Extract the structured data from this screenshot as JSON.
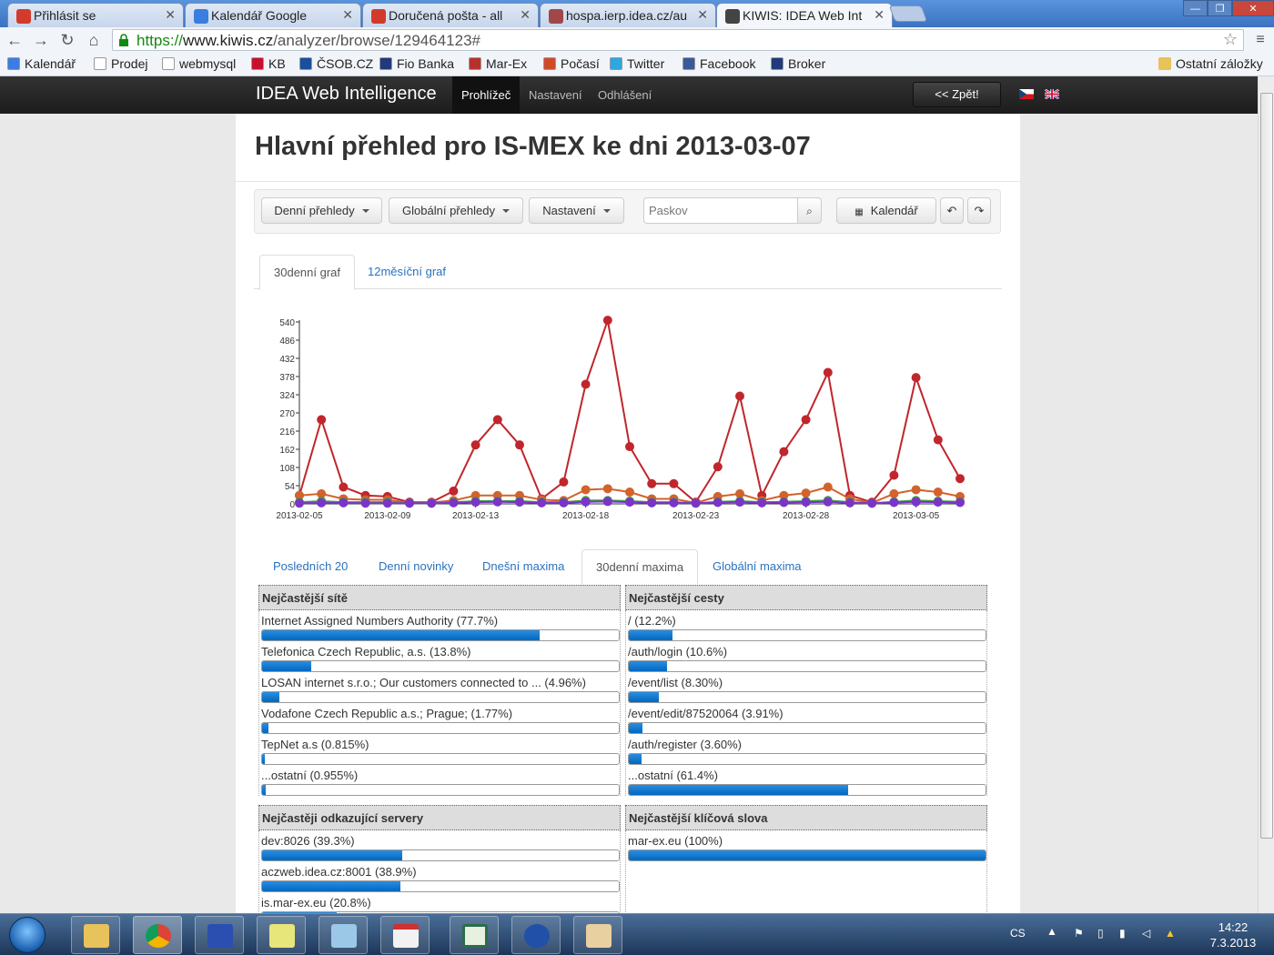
{
  "browser": {
    "tabs": [
      {
        "title": "Přihlásit se",
        "icon_color": "#d23b2c"
      },
      {
        "title": "Kalendář Google",
        "icon_color": "#3b7de0"
      },
      {
        "title": "Doručená pošta - all",
        "icon_color": "#d23b2c"
      },
      {
        "title": "hospa.ierp.idea.cz/au",
        "icon_color": "#a04848"
      },
      {
        "title": "KIWIS: IDEA Web Int",
        "icon_color": "#444444"
      }
    ],
    "url_scheme": "https://",
    "url_host": "www.kiwis.cz",
    "url_path": "/analyzer/browse/129464123#",
    "bookmarks": [
      {
        "label": "Kalendář",
        "color": "#3b7de0"
      },
      {
        "label": "Prodej",
        "color": "#ffffff"
      },
      {
        "label": "webmysql",
        "color": "#ffffff"
      },
      {
        "label": "KB",
        "color": "#c8102e"
      },
      {
        "label": "ČSOB.CZ",
        "color": "#1b4f9c"
      },
      {
        "label": "Fio Banka",
        "color": "#203a7a"
      },
      {
        "label": "Mar-Ex",
        "color": "#b8322c"
      },
      {
        "label": "Počasí",
        "color": "#d04a2a"
      },
      {
        "label": "Twitter",
        "color": "#2ca7e0"
      },
      {
        "label": "Facebook",
        "color": "#3b5998"
      },
      {
        "label": "Broker",
        "color": "#203a7a"
      }
    ],
    "other_bookmarks": "Ostatní záložky"
  },
  "navbar": {
    "brand": "IDEA Web Intelligence",
    "links": [
      "Prohlížeč",
      "Nastavení",
      "Odhlášení"
    ],
    "back": "<< Zpět!"
  },
  "page": {
    "title": "Hlavní přehled pro IS-MEX ke dni 2013-03-07",
    "dropdowns": [
      "Denní přehledy",
      "Globální přehledy",
      "Nastavení"
    ],
    "search_placeholder": "Paskov",
    "calendar_button": "Kalendář",
    "chart_tabs": [
      "30denní graf",
      "12měsíční graf"
    ],
    "stat_tabs": [
      "Posledních 20",
      "Denní novinky",
      "Dnešní maxima",
      "30denní maxima",
      "Globální maxima"
    ]
  },
  "panels": {
    "networks": {
      "title": "Nejčastější sítě",
      "rows": [
        {
          "label": "Internet Assigned Numbers Authority (77.7%)",
          "pct": 77.7
        },
        {
          "label": "Telefonica Czech Republic, a.s. (13.8%)",
          "pct": 13.8
        },
        {
          "label": "LOSAN internet s.r.o.; Our customers connected to ... (4.96%)",
          "pct": 4.96
        },
        {
          "label": "Vodafone Czech Republic a.s.; Prague; (1.77%)",
          "pct": 1.77
        },
        {
          "label": "TepNet a.s (0.815%)",
          "pct": 0.815
        },
        {
          "label": "...ostatní (0.955%)",
          "pct": 0.955
        }
      ]
    },
    "paths": {
      "title": "Nejčastější cesty",
      "rows": [
        {
          "label": "/ (12.2%)",
          "pct": 12.2
        },
        {
          "label": "/auth/login (10.6%)",
          "pct": 10.6
        },
        {
          "label": "/event/list (8.30%)",
          "pct": 8.3
        },
        {
          "label": "/event/edit/87520064 (3.91%)",
          "pct": 3.91
        },
        {
          "label": "/auth/register (3.60%)",
          "pct": 3.6
        },
        {
          "label": "...ostatní (61.4%)",
          "pct": 61.4
        }
      ]
    },
    "referrers": {
      "title": "Nejčastěji odkazující servery",
      "rows": [
        {
          "label": "dev:8026 (39.3%)",
          "pct": 39.3
        },
        {
          "label": "aczweb.idea.cz:8001 (38.9%)",
          "pct": 38.9
        },
        {
          "label": "is.mar-ex.eu (20.8%)",
          "pct": 20.8
        }
      ]
    },
    "keywords": {
      "title": "Nejčastější klíčová slova",
      "rows": [
        {
          "label": "mar-ex.eu (100%)",
          "pct": 100
        }
      ]
    }
  },
  "taskbar": {
    "lang": "CS",
    "time": "14:22",
    "date": "7.3.2013"
  },
  "chart_data": {
    "type": "line",
    "x": [
      "2013-02-05",
      "2013-02-06",
      "2013-02-07",
      "2013-02-08",
      "2013-02-09",
      "2013-02-10",
      "2013-02-11",
      "2013-02-12",
      "2013-02-13",
      "2013-02-14",
      "2013-02-15",
      "2013-02-16",
      "2013-02-17",
      "2013-02-18",
      "2013-02-19",
      "2013-02-20",
      "2013-02-21",
      "2013-02-22",
      "2013-02-23",
      "2013-02-24",
      "2013-02-25",
      "2013-02-26",
      "2013-02-27",
      "2013-02-28",
      "2013-03-01",
      "2013-03-02",
      "2013-03-03",
      "2013-03-04",
      "2013-03-05",
      "2013-03-06",
      "2013-03-07"
    ],
    "xticks": [
      "2013-02-05",
      "2013-02-09",
      "2013-02-13",
      "2013-02-18",
      "2013-02-23",
      "2013-02-28",
      "2013-03-05"
    ],
    "yticks": [
      0,
      54,
      108,
      162,
      216,
      270,
      324,
      378,
      432,
      486,
      540
    ],
    "ylim": [
      0,
      540
    ],
    "series": [
      {
        "color": "#c0262c",
        "values": [
          25,
          250,
          50,
          25,
          22,
          5,
          5,
          38,
          175,
          250,
          175,
          15,
          65,
          355,
          545,
          170,
          60,
          60,
          5,
          110,
          320,
          25,
          155,
          250,
          390,
          25,
          5,
          85,
          375,
          190,
          75
        ]
      },
      {
        "color": "#d2632a",
        "values": [
          25,
          30,
          15,
          12,
          12,
          3,
          4,
          10,
          25,
          25,
          25,
          12,
          10,
          42,
          45,
          35,
          15,
          15,
          3,
          22,
          30,
          10,
          25,
          32,
          50,
          15,
          3,
          30,
          42,
          35,
          22
        ]
      },
      {
        "color": "#3aa040",
        "values": [
          5,
          8,
          5,
          5,
          5,
          2,
          2,
          5,
          8,
          8,
          8,
          5,
          5,
          10,
          10,
          8,
          5,
          5,
          2,
          6,
          8,
          5,
          6,
          8,
          10,
          5,
          2,
          6,
          10,
          8,
          6
        ]
      },
      {
        "color": "#7a35c8",
        "values": [
          2,
          3,
          3,
          2,
          2,
          2,
          2,
          3,
          5,
          6,
          5,
          3,
          3,
          6,
          7,
          5,
          3,
          3,
          2,
          4,
          5,
          3,
          4,
          5,
          6,
          3,
          2,
          4,
          6,
          5,
          4
        ]
      }
    ],
    "grid": false
  }
}
